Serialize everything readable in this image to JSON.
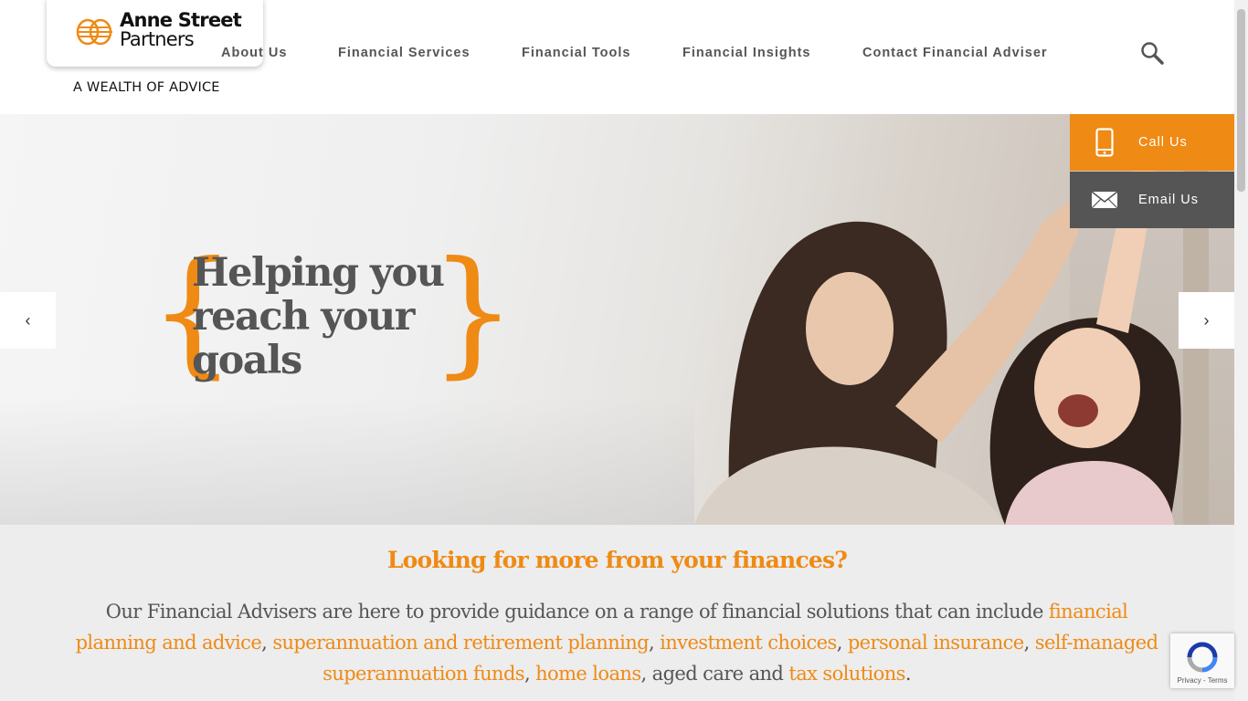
{
  "header": {
    "logo_line1": "Anne Street",
    "logo_line2": "Partners",
    "tagline": "A WEALTH OF ADVICE",
    "nav": [
      "About Us",
      "Financial Services",
      "Financial Tools",
      "Financial Insights",
      "Contact Financial Adviser"
    ],
    "search_icon": "search-icon"
  },
  "hero": {
    "heading_lines": [
      "Helping you",
      "reach your",
      "goals"
    ],
    "brace_open": "{",
    "brace_close": "}",
    "prev_label": "‹",
    "next_label": "›"
  },
  "cta": {
    "call_label": "Call Us",
    "email_label": "Email Us"
  },
  "intro": {
    "title": "Looking for more from your finances?",
    "text_before": "Our Financial Advisers are here to provide guidance on a range of financial solutions that can include ",
    "links": [
      "financial planning and advice",
      "superannuation and retirement planning",
      "investment choices",
      "personal insurance",
      "self-managed superannuation funds",
      "home loans",
      "tax solutions"
    ],
    "sep_comma": ", ",
    "aged_care": ", aged care and ",
    "end": "."
  },
  "recaptcha": {
    "links": "Privacy - Terms"
  },
  "colors": {
    "accent": "#ef8a14",
    "dark_grey": "#555555",
    "light_bg": "#ededed"
  }
}
